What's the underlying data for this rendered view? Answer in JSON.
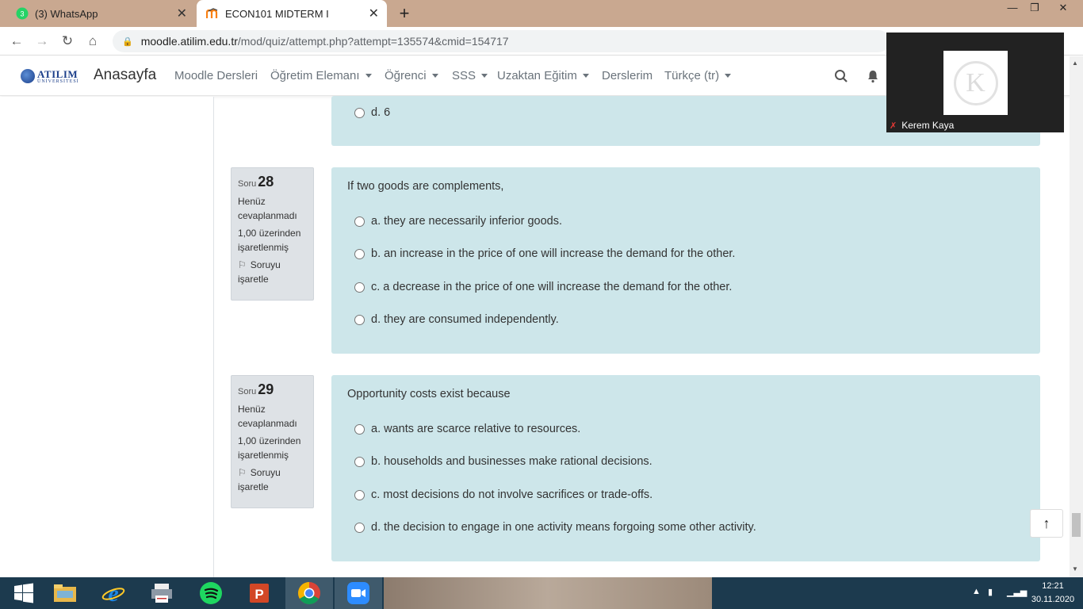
{
  "browser": {
    "tabs": [
      {
        "label": "(3) WhatsApp",
        "badge": "3"
      },
      {
        "label": "ECON101 MIDTERM I"
      }
    ],
    "url_host": "moodle.atilim.edu.tr",
    "url_path": "/mod/quiz/attempt.php?attempt=135574&cmid=154717"
  },
  "moodle_nav": {
    "logo_text": "ATILIM",
    "logo_subtext": "ÜNİVERSİTESİ",
    "brand": "Anasayfa",
    "items": [
      {
        "label": "Moodle Dersleri",
        "dropdown": false
      },
      {
        "label": "Öğretim Elemanı",
        "dropdown": true
      },
      {
        "label": "Öğrenci",
        "dropdown": true
      },
      {
        "label": "SSS",
        "dropdown": true
      },
      {
        "label": "Uzaktan Eğitim",
        "dropdown": true
      },
      {
        "label": "Derslerim",
        "dropdown": false
      },
      {
        "label": "Türkçe (tr)",
        "dropdown": true
      }
    ]
  },
  "prev_question": {
    "option_d": "d. 6"
  },
  "questions": [
    {
      "label": "Soru",
      "number": "28",
      "status": "Henüz cevaplanmadı",
      "points": "1,00 üzerinden işaretlenmiş",
      "flag": "Soruyu işaretle",
      "text": "If two goods are complements,",
      "options": [
        "a. they are necessarily inferior goods.",
        "b. an increase in the price of one will increase the demand for the other.",
        "c. a decrease in the price of one will increase the demand for the other.",
        "d. they are consumed independently."
      ]
    },
    {
      "label": "Soru",
      "number": "29",
      "status": "Henüz cevaplanmadı",
      "points": "1,00 üzerinden işaretlenmiş",
      "flag": "Soruyu işaretle",
      "text": "Opportunity costs exist because",
      "options": [
        "a. wants are scarce relative to resources.",
        "b. households and businesses make rational decisions.",
        "c. most decisions do not involve sacrifices or trade-offs.",
        "d. the decision to engage in one activity means forgoing some other activity."
      ]
    }
  ],
  "video": {
    "participant": "Kerem Kaya",
    "avatar_letter": "K"
  },
  "taskbar": {
    "time": "12:21",
    "date": "30.11.2020"
  },
  "colors": {
    "question_bg": "#cde6ea",
    "info_bg": "#dee2e6",
    "tabbar_bg": "#c9a890",
    "taskbar_bg": "#1c3a4e"
  }
}
